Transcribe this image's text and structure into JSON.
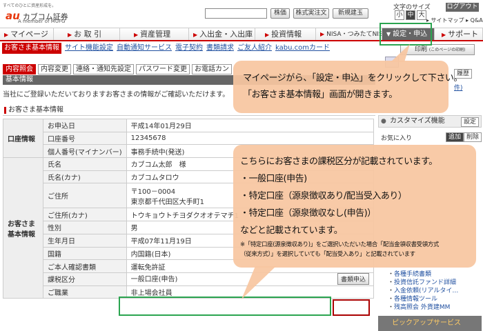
{
  "header": {
    "tagline": "すべてのひとに資産形成を。",
    "logo_au": "au",
    "logo_name": "カブコム証券",
    "logo_sub": "A member of MUFG",
    "search_btn_label": "株価",
    "announce_btn_label": "株式実注文",
    "new_issue_btn_label": "新規建玉",
    "font_size_label": "文字のサイズ",
    "font_small": "小",
    "font_medium": "中",
    "font_large": "大",
    "logout_label": "ログアウト",
    "links": "▸ サイトマップ ▸ Q&A"
  },
  "main_nav": [
    {
      "label": "マイページ"
    },
    {
      "label": "お 取 引"
    },
    {
      "label": "資産管理"
    },
    {
      "label": "入出金・入出庫"
    },
    {
      "label": "投資情報"
    },
    {
      "label": "NISA・つみたてNISA"
    },
    {
      "label": "設定・申込"
    },
    {
      "label": "サポート"
    }
  ],
  "sub_nav": [
    {
      "label": "お客さま基本情報"
    },
    {
      "label": "サイト機能設定"
    },
    {
      "label": "自動通知サービス"
    },
    {
      "label": "電子契約"
    },
    {
      "label": "書類請求"
    },
    {
      "label": "ご友人紹介"
    },
    {
      "label": "kabu.comカード"
    }
  ],
  "print_label": "印刷",
  "print_sub": "(このページの印刷)",
  "tabs": [
    {
      "label": "内容照会"
    },
    {
      "label": "内容変更"
    },
    {
      "label": "連絡・通知先設定"
    },
    {
      "label": "パスワード変更"
    },
    {
      "label": "お電話カン"
    }
  ],
  "section_bar": "基本情報",
  "intro_text": "当社にご登録いただいておりますお客さまの情報がご確認いただけます。",
  "section_title": "お客さま基本情報",
  "account_group": "口座情報",
  "customer_group": "お客さま基本情報",
  "rows": [
    {
      "key": "お申込日",
      "value": "平成14年01月29日"
    },
    {
      "key": "口座番号",
      "value": "12345678"
    },
    {
      "key": "個人番号(マイナンバー)",
      "value": "事務手続中(発送)"
    },
    {
      "key": "氏名",
      "value": "カブコム太郎　様"
    },
    {
      "key": "氏名(カナ)",
      "value": "カブコムタロウ"
    },
    {
      "key": "ご住所",
      "value": "〒100－0004",
      "value2": "東京都千代田区大手町1"
    },
    {
      "key": "ご住所(カナ)",
      "value": "トウキョウトチヨダクオオテマチ1"
    },
    {
      "key": "性別",
      "value": "男"
    },
    {
      "key": "生年月日",
      "value": "平成07年11月19日"
    },
    {
      "key": "国籍",
      "value": "内国籍(日本)"
    },
    {
      "key": "ご本人確認書類",
      "value": "運転免許証"
    },
    {
      "key": "課税区分",
      "value": "一般口座(申告)",
      "button": "書類申込"
    },
    {
      "key": "ご職業",
      "value": "非上場会社員"
    }
  ],
  "sidebar": {
    "btn_a": "履歴",
    "link_a": "件)",
    "custom_title": "カスタマイズ機能",
    "custom_btn": "設定",
    "fav_label": "お気に入り",
    "add_btn": "追加",
    "del_btn": "削除",
    "list": [
      "各種手続書類",
      "投資信託ファンド詳細",
      "入金依頼(リアルタイ…",
      "各種情報ツール",
      "残高照会 外貨建MM"
    ],
    "bottom": "ピックアップサービス"
  },
  "callout1": {
    "line1": "マイページがら、「設定・申込」をクリックして下さい。",
    "line2": "「お客さま基本情報」画面が開きます。"
  },
  "callout2": {
    "line1": "こちらにお客さまの課税区分が記載されています。",
    "line2": "・一般口座(申告)",
    "line3": "・特定口座（源泉徴収あり/配当受入あり）",
    "line4": "・特定口座（源泉徴収なし(申告)）",
    "line5": "などと記載されています。",
    "note1": "※「特定口座(源泉徴収あり)」をご選択いただいた場合「配当金領収書受領方式",
    "note2": "（従来方式）」を選択していても「配当受入あり」と記載されています"
  },
  "colors": {
    "brand_red": "#cc0000",
    "highlight_green": "#2aa44f",
    "callout_bg": "#f8c6a0"
  }
}
